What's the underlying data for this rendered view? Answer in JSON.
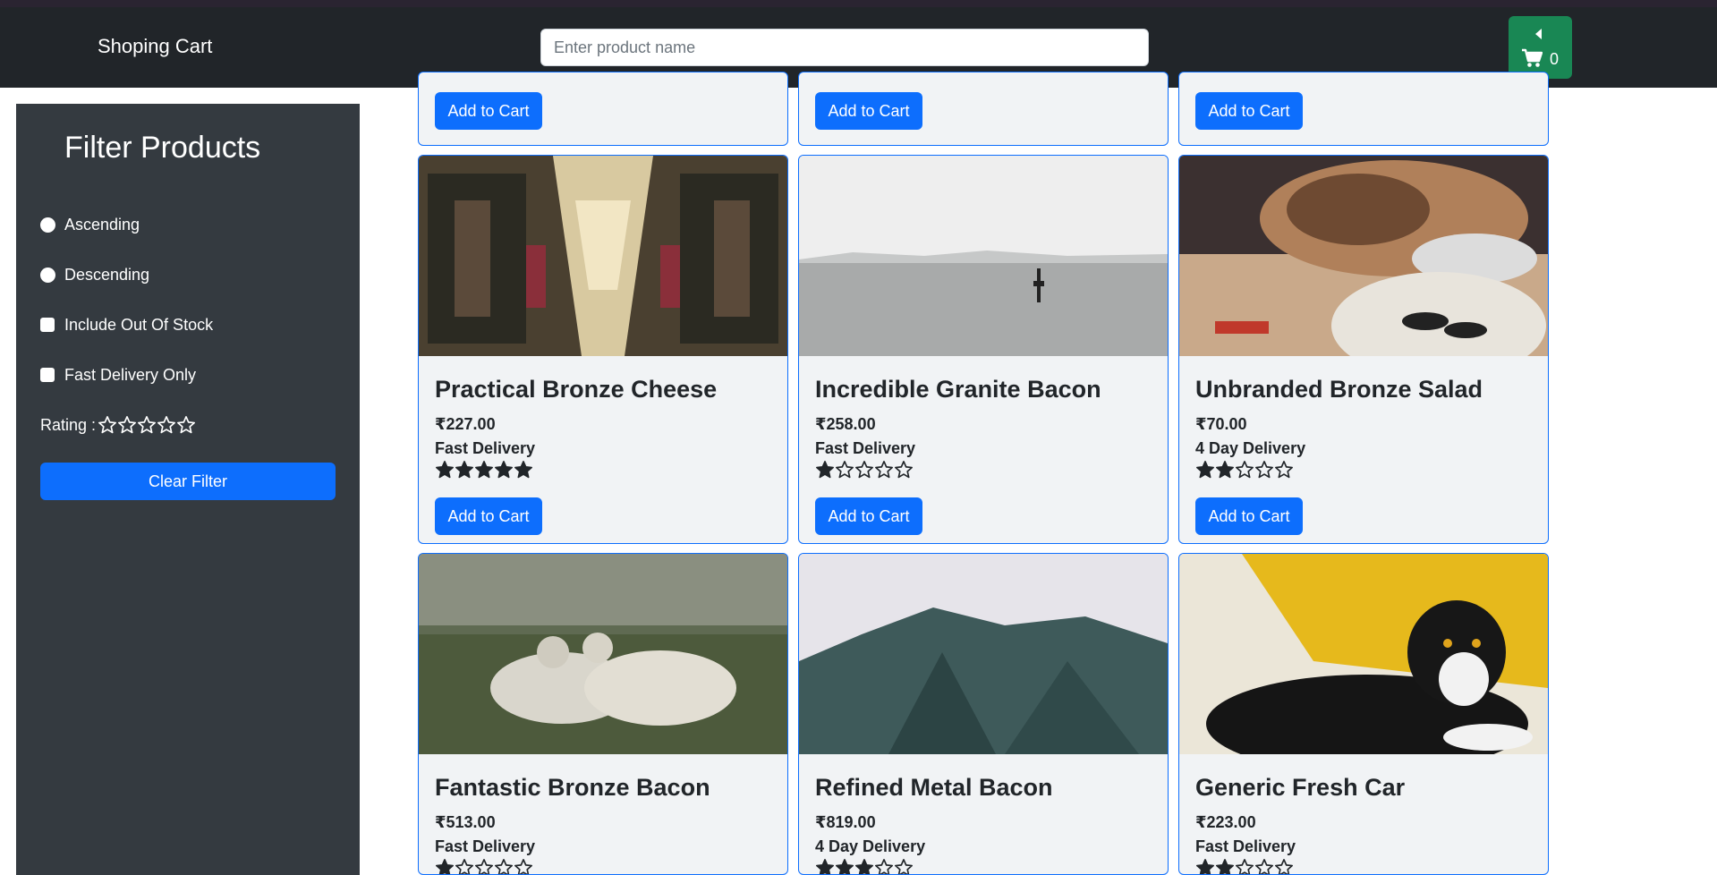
{
  "navbar": {
    "brand": "Shoping Cart",
    "search_placeholder": "Enter product name",
    "cart_count": "0"
  },
  "sidebar": {
    "title": "Filter Products",
    "options": [
      "Ascending",
      "Descending",
      "Include Out Of Stock",
      "Fast Delivery Only"
    ],
    "rating_label": "Rating :",
    "rating_value": 0,
    "clear_label": "Clear Filter"
  },
  "add_to_cart_label": "Add to Cart",
  "products": [
    {
      "name": "Practical Bronze Cheese",
      "price": "₹227.00",
      "delivery": "Fast Delivery",
      "rating": 5
    },
    {
      "name": "Incredible Granite Bacon",
      "price": "₹258.00",
      "delivery": "Fast Delivery",
      "rating": 1
    },
    {
      "name": "Unbranded Bronze Salad",
      "price": "₹70.00",
      "delivery": "4 Day Delivery",
      "rating": 2
    },
    {
      "name": "Fantastic Bronze Bacon",
      "price": "₹513.00",
      "delivery": "Fast Delivery",
      "rating": 1
    },
    {
      "name": "Refined Metal Bacon",
      "price": "₹819.00",
      "delivery": "4 Day Delivery",
      "rating": 3
    },
    {
      "name": "Generic Fresh Car",
      "price": "₹223.00",
      "delivery": "Fast Delivery",
      "rating": 2
    }
  ],
  "colors": {
    "primary": "#0d6efd",
    "success": "#198754",
    "navbar": "#212529",
    "sidebar": "#343a40"
  }
}
